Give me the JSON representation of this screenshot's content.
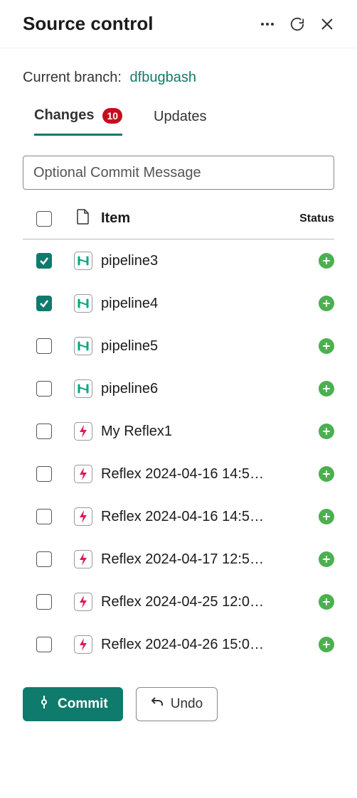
{
  "header": {
    "title": "Source control"
  },
  "branch": {
    "label": "Current branch:",
    "name": "dfbugbash"
  },
  "tabs": {
    "changes": {
      "label": "Changes",
      "count": "10"
    },
    "updates": {
      "label": "Updates"
    }
  },
  "commit_message": {
    "placeholder": "Optional Commit Message",
    "value": ""
  },
  "table_headers": {
    "item": "Item",
    "status": "Status"
  },
  "items": [
    {
      "checked": true,
      "type": "pipeline",
      "name": "pipeline3",
      "status": "added"
    },
    {
      "checked": true,
      "type": "pipeline",
      "name": "pipeline4",
      "status": "added"
    },
    {
      "checked": false,
      "type": "pipeline",
      "name": "pipeline5",
      "status": "added"
    },
    {
      "checked": false,
      "type": "pipeline",
      "name": "pipeline6",
      "status": "added"
    },
    {
      "checked": false,
      "type": "reflex",
      "name": "My Reflex1",
      "status": "added"
    },
    {
      "checked": false,
      "type": "reflex",
      "name": "Reflex 2024-04-16 14:5…",
      "status": "added"
    },
    {
      "checked": false,
      "type": "reflex",
      "name": "Reflex 2024-04-16 14:5…",
      "status": "added"
    },
    {
      "checked": false,
      "type": "reflex",
      "name": "Reflex 2024-04-17 12:5…",
      "status": "added"
    },
    {
      "checked": false,
      "type": "reflex",
      "name": "Reflex 2024-04-25 12:0…",
      "status": "added"
    },
    {
      "checked": false,
      "type": "reflex",
      "name": "Reflex 2024-04-26 15:0…",
      "status": "added"
    }
  ],
  "actions": {
    "commit": "Commit",
    "undo": "Undo"
  },
  "colors": {
    "accent": "#0f7b6c",
    "badge": "#c50f1f",
    "added": "#4caf50",
    "reflex": "#d81b60",
    "pipeline": "#00a884"
  }
}
